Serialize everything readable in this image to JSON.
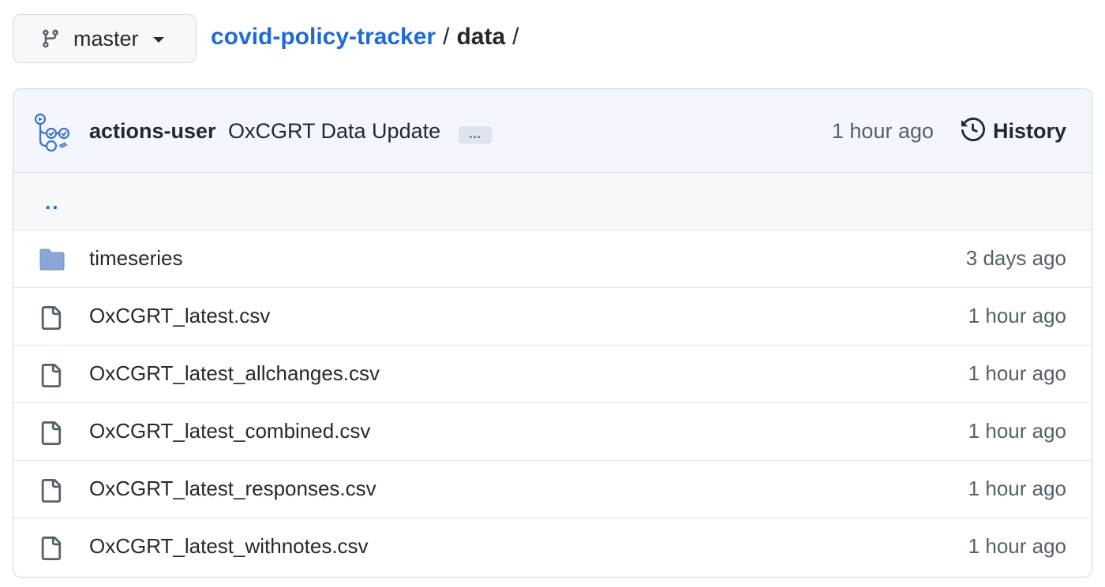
{
  "branch": {
    "name": "master",
    "icon": "git-branch-icon"
  },
  "breadcrumb": {
    "repo": "covid-policy-tracker",
    "separator": "/",
    "dir": "data",
    "trailing": "/"
  },
  "commit": {
    "author": "actions-user",
    "message": "OxCGRT Data Update",
    "ellipsis": "…",
    "time": "1 hour ago",
    "history_label": "History"
  },
  "parent_link": "..",
  "files": [
    {
      "name": "timeseries",
      "type": "folder",
      "icon": "folder-icon",
      "updated": "3 days ago"
    },
    {
      "name": "OxCGRT_latest.csv",
      "type": "file",
      "icon": "file-icon",
      "updated": "1 hour ago"
    },
    {
      "name": "OxCGRT_latest_allchanges.csv",
      "type": "file",
      "icon": "file-icon",
      "updated": "1 hour ago"
    },
    {
      "name": "OxCGRT_latest_combined.csv",
      "type": "file",
      "icon": "file-icon",
      "updated": "1 hour ago"
    },
    {
      "name": "OxCGRT_latest_responses.csv",
      "type": "file",
      "icon": "file-icon",
      "updated": "1 hour ago"
    },
    {
      "name": "OxCGRT_latest_withnotes.csv",
      "type": "file",
      "icon": "file-icon",
      "updated": "1 hour ago"
    }
  ],
  "colors": {
    "link": "#1f6bd6",
    "folder": "#8aa6d6",
    "commit_bar_bg": "#f3f7fd"
  }
}
